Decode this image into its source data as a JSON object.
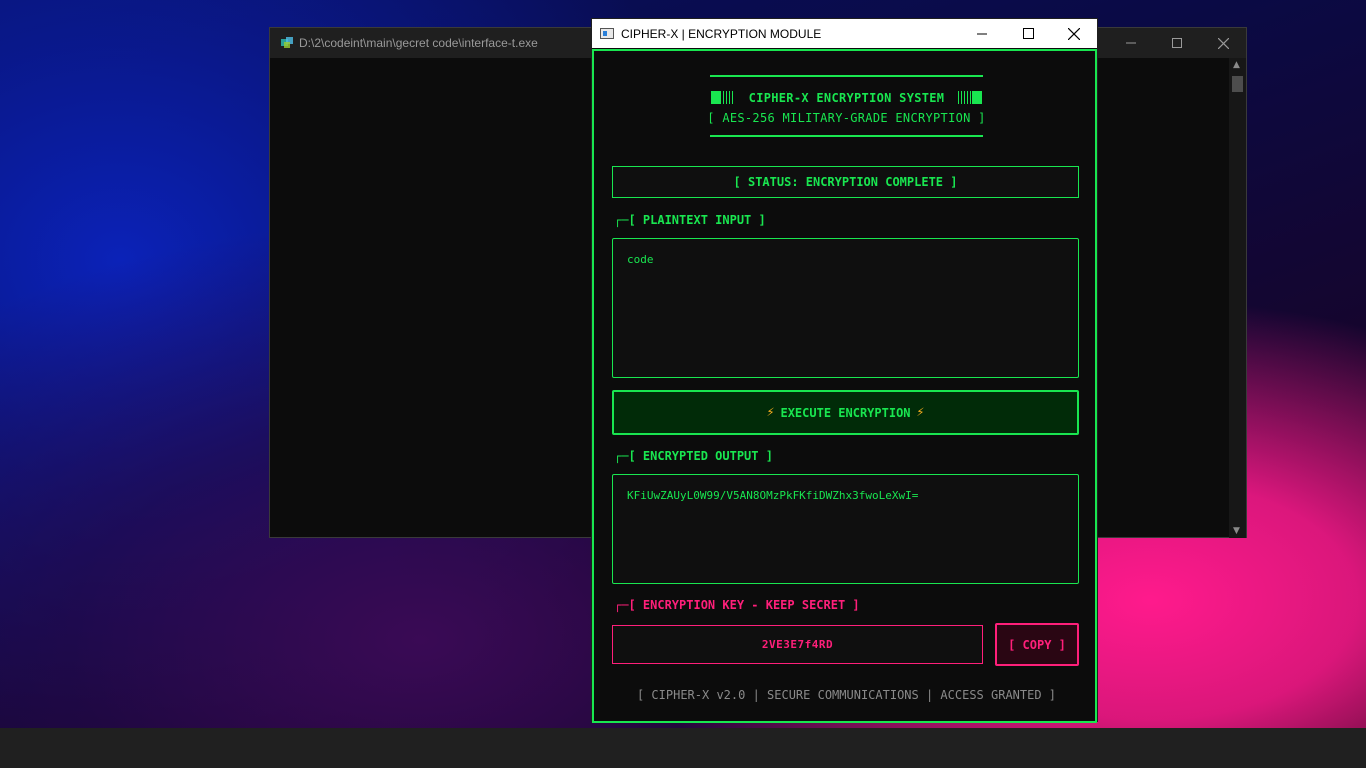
{
  "console": {
    "title": "D:\\2\\codeint\\main\\gecret code\\interface-t.exe"
  },
  "cipher_window": {
    "title": "CIPHER-X | ENCRYPTION MODULE"
  },
  "header": {
    "title": "CIPHER-X ENCRYPTION SYSTEM",
    "subtitle": "[ AES-256 MILITARY-GRADE ENCRYPTION ]"
  },
  "status": {
    "text": "[ STATUS: ENCRYPTION COMPLETE ]"
  },
  "plaintext": {
    "corner": "┌─",
    "label": "[ PLAINTEXT INPUT ]",
    "value": "code"
  },
  "execute": {
    "bolt": "⚡",
    "label": "EXECUTE ENCRYPTION"
  },
  "output": {
    "corner": "┌─",
    "label": "[ ENCRYPTED OUTPUT ]",
    "value": "KFiUwZAUyL0W99/V5AN8OMzPkFKfiDWZhx3fwoLeXwI="
  },
  "key": {
    "corner": "┌─",
    "label": "[ ENCRYPTION KEY - KEEP SECRET ]",
    "value": "2VE3E7f4RD",
    "copy_label": "[ COPY ]"
  },
  "footer": {
    "text": "[ CIPHER-X v2.0 | SECURE COMMUNICATIONS | ACCESS GRANTED ]"
  },
  "colors": {
    "accent": "#19e650",
    "danger": "#ff1f7a",
    "bolt": "#ffb01f"
  }
}
